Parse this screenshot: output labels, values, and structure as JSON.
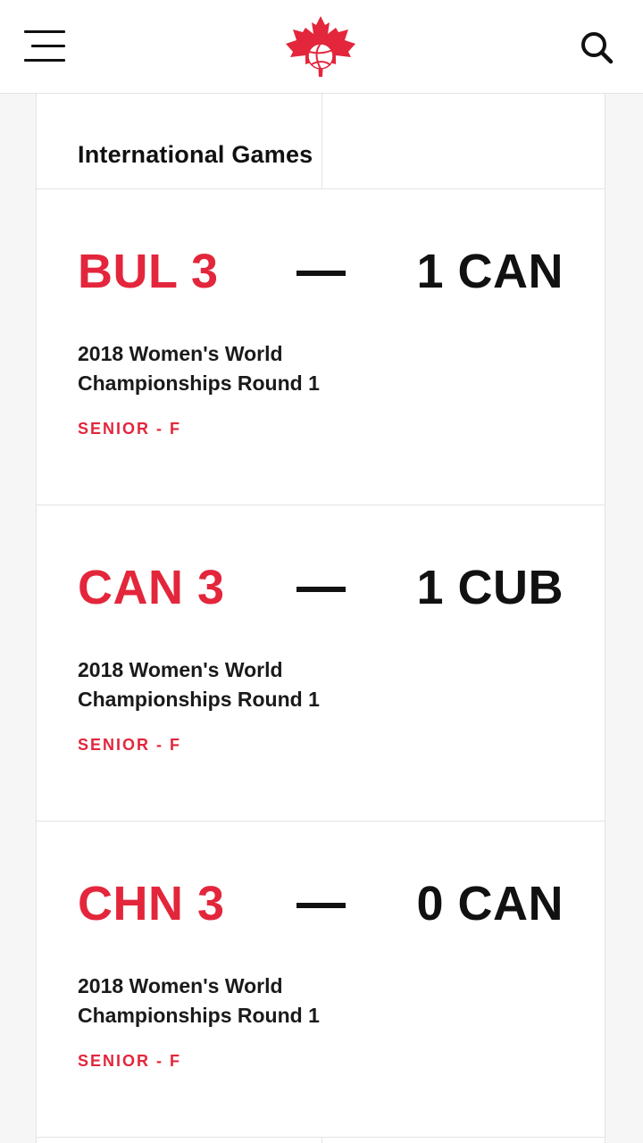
{
  "header": {
    "menu_icon": "hamburger-menu-icon",
    "logo_icon": "maple-leaf-volleyball-logo",
    "search_icon": "search-icon",
    "brand_color": "#e3263b"
  },
  "section": {
    "title": "International Games"
  },
  "games": [
    {
      "home": "BUL 3",
      "away": "1 CAN",
      "event": "2018 Women's World Championships Round 1",
      "category": "SENIOR - F"
    },
    {
      "home": "CAN 3",
      "away": "1 CUB",
      "event": "2018 Women's World Championships Round 1",
      "category": "SENIOR - F"
    },
    {
      "home": "CHN 3",
      "away": "0 CAN",
      "event": "2018 Women's World Championships Round 1",
      "category": "SENIOR - F"
    }
  ]
}
